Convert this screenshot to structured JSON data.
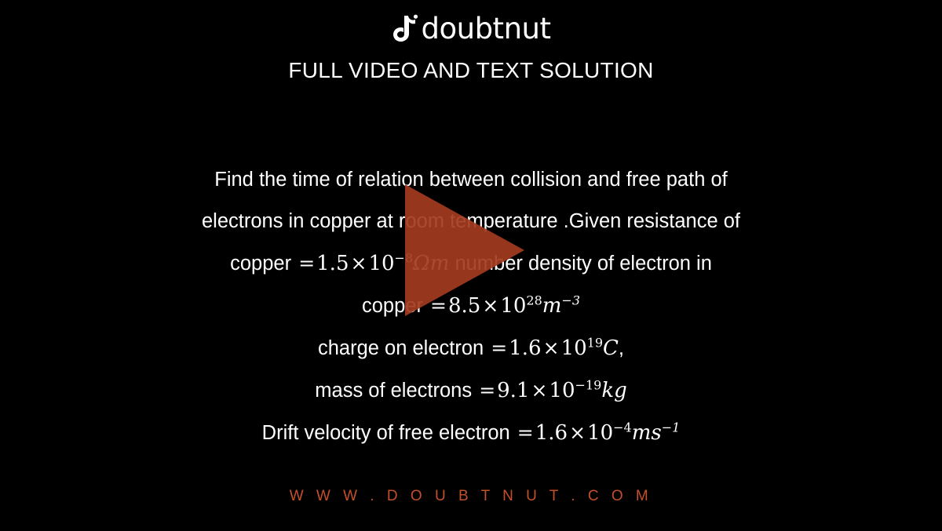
{
  "brand": {
    "logo_icon": "doubtnut-note-icon",
    "logo_text": "doubtnut"
  },
  "header": {
    "subtitle": "FULL VIDEO AND TEXT SOLUTION"
  },
  "question": {
    "line1": "Find the time of relation between collision and free path of",
    "line2": "electrons in copper at room temperature .Given resistance of",
    "line3_prefix": "copper ",
    "line3_eq_sign": "=",
    "line3_value": "1.5",
    "line3_times": "×",
    "line3_base": "10",
    "line3_exp": "−8",
    "line3_unit": "Ωm",
    "line3_suffix": " number density of electron in",
    "line4_prefix": "copper ",
    "line4_eq_sign": "=",
    "line4_value": "8.5",
    "line4_times": "×",
    "line4_base": "10",
    "line4_exp": "28",
    "line4_unit": "m",
    "line4_unit_exp": "−3",
    "line5_prefix": "charge on electron ",
    "line5_eq_sign": "=",
    "line5_value": "1.6",
    "line5_times": "×",
    "line5_base": "10",
    "line5_exp": "19",
    "line5_unit": "C",
    "line5_suffix": ",",
    "line6_prefix": "mass of electrons ",
    "line6_eq_sign": "=",
    "line6_value": "9.1",
    "line6_times": "×",
    "line6_base": "10",
    "line6_exp": "−19",
    "line6_unit": "kg",
    "line7_prefix": "Drift velocity of free electron ",
    "line7_eq_sign": "=",
    "line7_value": "1.6",
    "line7_times": "×",
    "line7_base": "10",
    "line7_exp": "−4",
    "line7_unit": "ms",
    "line7_unit_exp": "−1"
  },
  "player": {
    "play_icon": "play-triangle-icon",
    "accent_color": "#a33b1f"
  },
  "footer": {
    "website": "W W W . D O U B T N U T . C O M",
    "color": "#c4502a"
  }
}
